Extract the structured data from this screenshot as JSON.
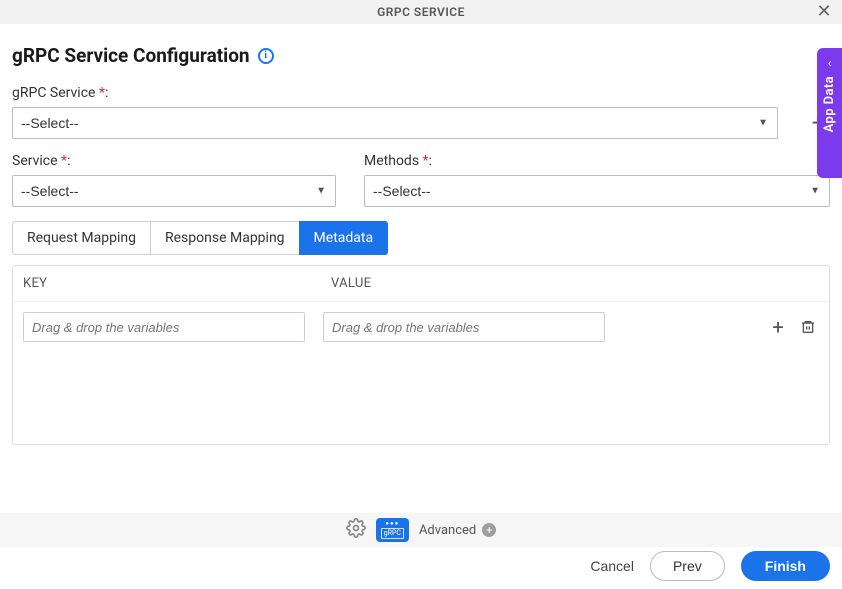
{
  "header": {
    "title": "GRPC SERVICE"
  },
  "page": {
    "heading": "gRPC Service Configuration"
  },
  "form": {
    "grpc_service_label": "gRPC Service",
    "grpc_service_value": "--Select--",
    "service_label": "Service",
    "service_value": "--Select--",
    "methods_label": "Methods",
    "methods_value": "--Select--"
  },
  "tabs": {
    "request": "Request Mapping",
    "response": "Response Mapping",
    "metadata": "Metadata",
    "active": "metadata"
  },
  "metadata_table": {
    "col_key": "KEY",
    "col_value": "VALUE",
    "placeholder": "Drag & drop the variables"
  },
  "footer": {
    "advanced": "Advanced"
  },
  "buttons": {
    "cancel": "Cancel",
    "prev": "Prev",
    "finish": "Finish"
  },
  "side": {
    "label": "App Data"
  },
  "colors": {
    "primary": "#1a73e8",
    "accent": "#7c3aed"
  }
}
